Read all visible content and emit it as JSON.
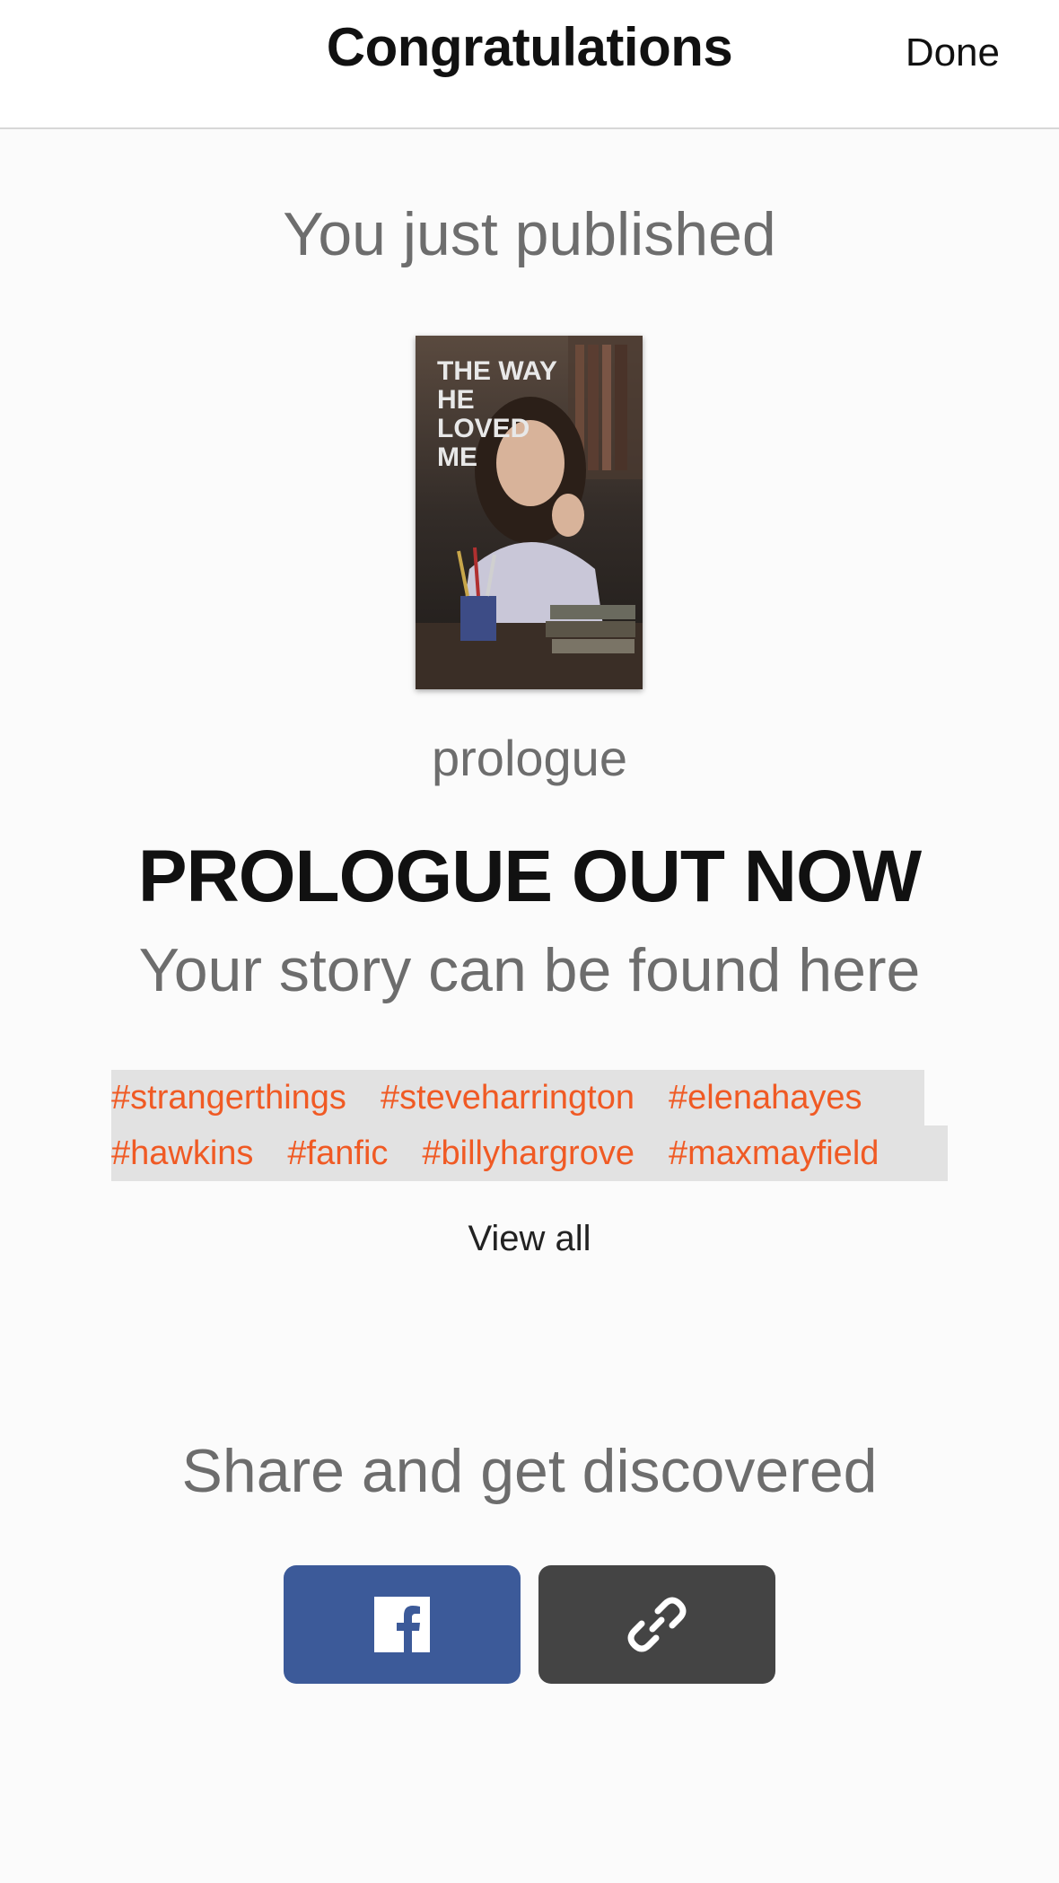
{
  "header": {
    "title": "Congratulations",
    "done_label": "Done"
  },
  "main": {
    "published_label": "You just published",
    "cover": {
      "title_text": "THE WAY HE LOVED ME"
    },
    "part_title": "prologue",
    "headline": "PROLOGUE OUT NOW",
    "found_label": "Your story can be found here",
    "tags": [
      [
        "#strangerthings",
        "#steveharrington",
        "#elenahayes"
      ],
      [
        "#hawkins",
        "#fanfic",
        "#billyhargrove",
        "#maxmayfield"
      ]
    ],
    "view_all_label": "View all"
  },
  "share": {
    "label": "Share and get discovered",
    "buttons": [
      {
        "name": "facebook",
        "icon": "facebook-icon",
        "color": "#3c5a99"
      },
      {
        "name": "copy-link",
        "icon": "link-icon",
        "color": "#444444"
      }
    ]
  },
  "colors": {
    "tag": "#f05a24",
    "tag_bg": "#e2e2e2",
    "muted_text": "#6d6d6d"
  }
}
